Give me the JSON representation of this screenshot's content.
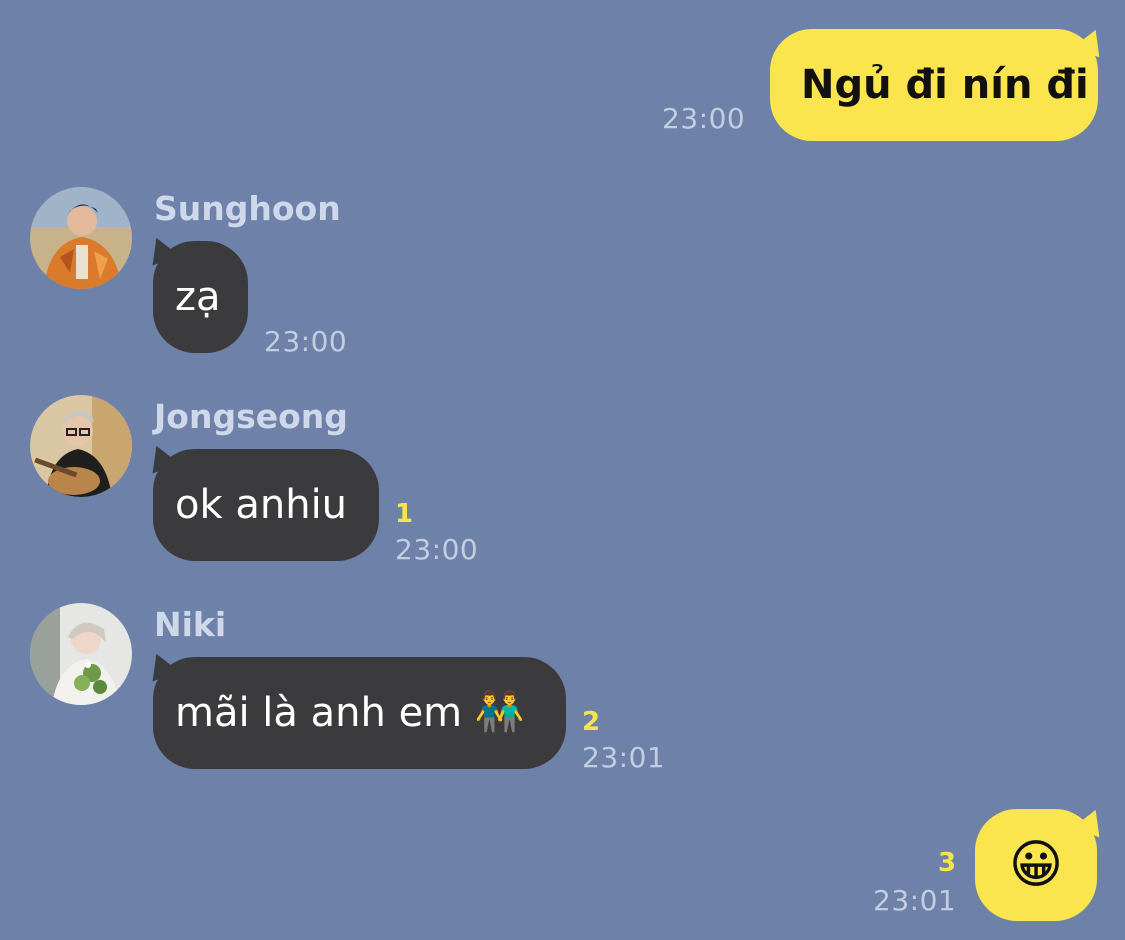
{
  "messages": [
    {
      "direction": "out",
      "text": "Ngủ đi nín đi",
      "time": "23:00"
    },
    {
      "direction": "in",
      "sender": "Sunghoon",
      "text": "zạ",
      "time": "23:00",
      "avatar_icon": "profile-photo-sunghoon"
    },
    {
      "direction": "in",
      "sender": "Jongseong",
      "text": "ok anhiu",
      "time": "23:00",
      "unread": "1",
      "avatar_icon": "profile-photo-jongseong"
    },
    {
      "direction": "in",
      "sender": "Niki",
      "text": "mãi là anh em 👬",
      "time": "23:01",
      "unread": "2",
      "avatar_icon": "profile-photo-niki"
    },
    {
      "direction": "out",
      "text": "😀",
      "time": "23:01",
      "unread": "3"
    }
  ],
  "colors": {
    "background": "#6e81a8",
    "outgoing_bubble": "#fbe54f",
    "incoming_bubble": "#3b3b3d",
    "unread_count": "#f5e44c",
    "timestamp": "#c3cde0"
  }
}
